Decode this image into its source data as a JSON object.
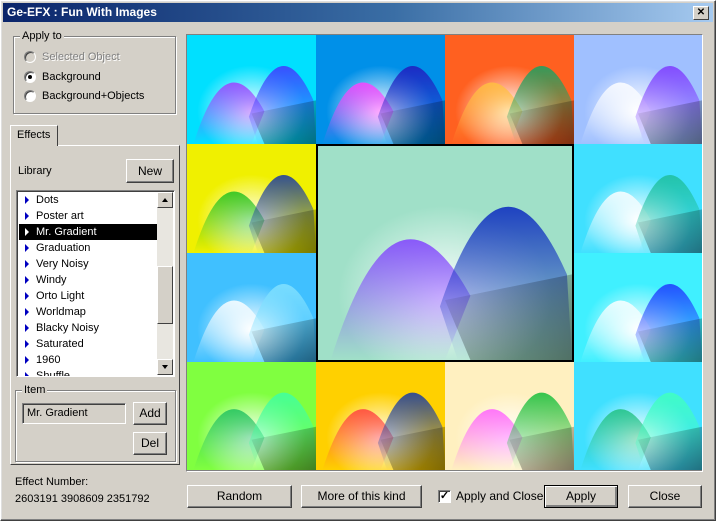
{
  "window": {
    "title": "Ge-EFX : Fun With Images",
    "close_glyph": "✕"
  },
  "apply_to": {
    "label": "Apply to",
    "options": [
      {
        "label": "Selected Object",
        "checked": false,
        "disabled": true
      },
      {
        "label": "Background",
        "checked": true,
        "disabled": false
      },
      {
        "label": "Background+Objects",
        "checked": false,
        "disabled": false
      }
    ]
  },
  "effects": {
    "tab_label": "Effects",
    "library_label": "Library",
    "new_label": "New",
    "library_items": [
      "Dots",
      "Poster art",
      "Mr. Gradient",
      "Graduation",
      "Very Noisy",
      "Windy",
      "Orto Light",
      "Worldmap",
      "Blacky Noisy",
      "Saturated",
      "1960",
      "Shuffle"
    ],
    "selected_index": 2
  },
  "item": {
    "label": "Item",
    "value": "Mr. Gradient",
    "add_label": "Add",
    "del_label": "Del"
  },
  "effect_number": {
    "label": "Effect Number:",
    "value": "2603191 3908609 2351792"
  },
  "buttons": {
    "random": "Random",
    "more": "More of this kind",
    "apply_close": "Apply and Close",
    "apply_close_checked": true,
    "apply": "Apply",
    "close": "Close"
  },
  "tiles": [
    {
      "bg": "#00e0ff",
      "c1": "#a040ff",
      "c2": "#4040ff"
    },
    {
      "bg": "#0090e8",
      "c1": "#ff40ff",
      "c2": "#2020c0"
    },
    {
      "bg": "#ff6020",
      "c1": "#ffc040",
      "c2": "#20a060"
    },
    {
      "bg": "#a0c0ff",
      "c1": "#ffffff",
      "c2": "#8040ff"
    },
    {
      "bg": "#f0f000",
      "c1": "#20c020",
      "c2": "#2040a0"
    },
    {
      "bg": "#a0e0c8",
      "c1": "#8040ff",
      "c2": "#1030c0"
    },
    {
      "bg": "#40e0ff",
      "c1": "#ffffff",
      "c2": "#20c0a0"
    },
    {
      "bg": "#40c0ff",
      "c1": "#ffffff",
      "c2": "#80e0ff"
    },
    {
      "bg": "#40f0ff",
      "c1": "#ffffff",
      "c2": "#2040ff"
    },
    {
      "bg": "#80ff40",
      "c1": "#20c060",
      "c2": "#40ffa0"
    },
    {
      "bg": "#ffd000",
      "c1": "#ff4040",
      "c2": "#2040a0"
    },
    {
      "bg": "#fff0c0",
      "c1": "#ff60ff",
      "c2": "#20c040"
    },
    {
      "bg": "#40e0ff",
      "c1": "#20c080",
      "c2": "#40ffc0"
    }
  ]
}
